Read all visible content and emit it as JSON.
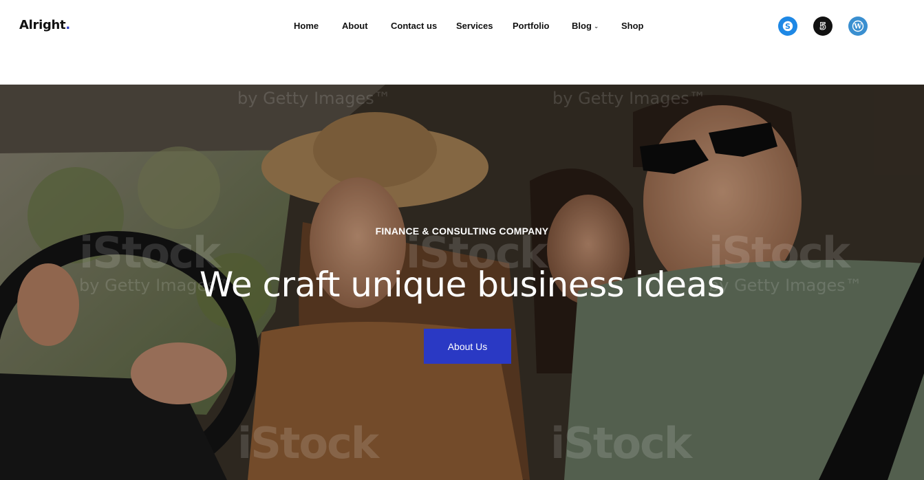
{
  "header": {
    "logo_text": "Alright",
    "logo_dot": ".",
    "nav": [
      {
        "label": "Home"
      },
      {
        "label": "About"
      },
      {
        "label": "Contact us"
      },
      {
        "label": "Services"
      },
      {
        "label": "Portfolio"
      },
      {
        "label": "Blog",
        "has_dropdown": true
      },
      {
        "label": "Shop"
      }
    ],
    "social": [
      {
        "icon": "skype-icon",
        "color": "#1e88e5"
      },
      {
        "icon": "500px-icon",
        "color": "#111111"
      },
      {
        "icon": "wordpress-icon",
        "color": "#3a8fd0"
      }
    ]
  },
  "hero": {
    "eyebrow": "FINANCE & CONSULTING COMPANY",
    "headline": "We craft unique business ideas",
    "cta_label": "About Us",
    "accent_color": "#2a39c4",
    "watermarks": {
      "brand": "iStock",
      "credit": "by Getty Images™"
    }
  },
  "colors": {
    "accent": "#2a39c4",
    "text_dark": "#111111",
    "text_light": "#ffffff"
  }
}
